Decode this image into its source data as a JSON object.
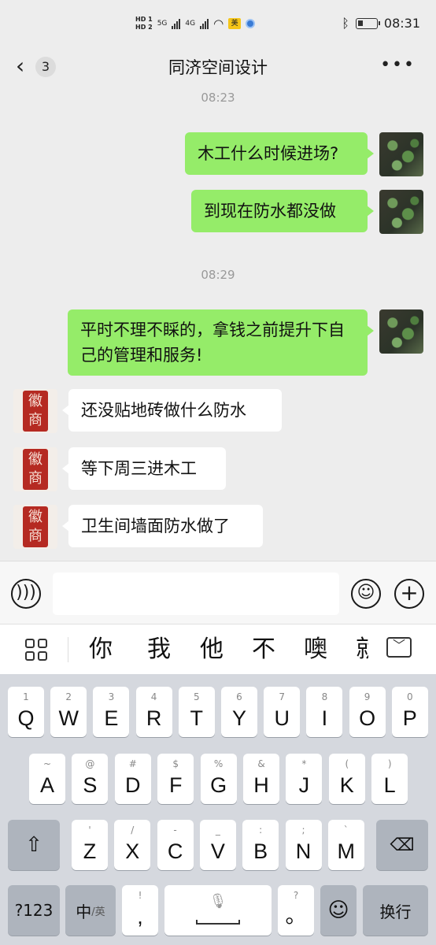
{
  "status_bar": {
    "hd1": "HD 1",
    "hd2": "HD 2",
    "net1": "5G",
    "net2": "4G",
    "badge": "美",
    "time": "08:31"
  },
  "nav": {
    "back_icon": "chevron-left",
    "unread_count": "3",
    "title": "同济空间设计",
    "more_icon": "more-horizontal"
  },
  "messages": [
    {
      "type": "time",
      "text": "08:23"
    },
    {
      "type": "sent",
      "text": "木工什么时候进场?"
    },
    {
      "type": "sent",
      "text": "到现在防水都没做"
    },
    {
      "type": "time",
      "text": "08:29"
    },
    {
      "type": "sent",
      "text": "平时不理不睬的，拿钱之前提升下自己的管理和服务!"
    },
    {
      "type": "received",
      "text": "还没贴地砖做什么防水"
    },
    {
      "type": "received",
      "text": "等下周三进木工"
    },
    {
      "type": "received",
      "text": "卫生间墙面防水做了"
    }
  ],
  "avatar_seal": [
    "徽",
    "商"
  ],
  "input_bar": {
    "voice_icon": "voice-icon",
    "text_value": "",
    "emoji_icon": "emoji-icon",
    "plus_icon": "plus-icon"
  },
  "candidates": [
    "你",
    "我",
    "他",
    "不",
    "噢",
    "就"
  ],
  "keyboard": {
    "row1": [
      [
        "Q",
        "1"
      ],
      [
        "W",
        "2"
      ],
      [
        "E",
        "3"
      ],
      [
        "R",
        "4"
      ],
      [
        "T",
        "5"
      ],
      [
        "Y",
        "6"
      ],
      [
        "U",
        "7"
      ],
      [
        "I",
        "8"
      ],
      [
        "O",
        "9"
      ],
      [
        "P",
        "0"
      ]
    ],
    "row2": [
      [
        "A",
        "~"
      ],
      [
        "S",
        "@"
      ],
      [
        "D",
        "#"
      ],
      [
        "F",
        "$"
      ],
      [
        "G",
        "%"
      ],
      [
        "H",
        "&"
      ],
      [
        "J",
        "*"
      ],
      [
        "K",
        "("
      ],
      [
        "L",
        ")"
      ]
    ],
    "row3": [
      [
        "Z",
        "'"
      ],
      [
        "X",
        "/"
      ],
      [
        "C",
        "-"
      ],
      [
        "V",
        "_"
      ],
      [
        "B",
        ":"
      ],
      [
        "N",
        ";"
      ],
      [
        "M",
        "`"
      ]
    ],
    "num_key": "?123",
    "lang_key_main": "中",
    "lang_key_sub": "/英",
    "comma": ",",
    "comma_sub": "!",
    "period": "。",
    "period_sub": "?",
    "enter_key": "换行",
    "colors": {
      "sent_bubble": "#95ec69",
      "received_bubble": "#ffffff",
      "chat_bg": "#ededed",
      "keyboard_bg": "#d5d8de"
    }
  }
}
